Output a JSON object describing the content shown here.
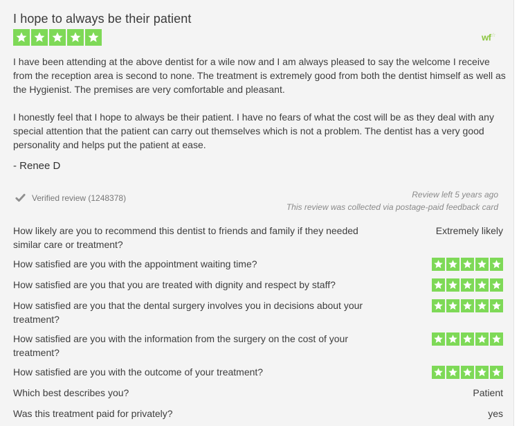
{
  "review": {
    "title": "I hope to always be their patient",
    "rating_stars": 5,
    "logo_text": "wf",
    "paragraphs": [
      "I have been attending at the above dentist for a wile now and I am always pleased to say the welcome I receive from the reception area is second to none. The treatment is extremely good from both the dentist himself as well as the Hygienist. The premises are very comfortable and pleasant.",
      "I honestly feel that I hope to always be their patient. I have no fears of what the cost will be as they deal with any special attention that the patient can carry out themselves which is not a problem. The dentist has a very good personality and helps put the patient at ease."
    ],
    "author": "- Renee D",
    "verified_label": "Verified review (1248378)",
    "review_age": "Review left 5 years ago",
    "collection_note": "This review was collected via postage-paid feedback card"
  },
  "questions": [
    {
      "question": "How likely are you to recommend this dentist to friends and family if they needed similar care or treatment?",
      "answer": "Extremely likely"
    },
    {
      "question": "How satisfied are you with the appointment waiting time?",
      "stars": 5
    },
    {
      "question": "How satisfied are you that you are treated with dignity and respect by staff?",
      "stars": 5
    },
    {
      "question": "How satisfied are you that the dental surgery involves you in decisions about your treatment?",
      "stars": 5
    },
    {
      "question": "How satisfied are you with the information from the surgery on the cost of your treatment?",
      "stars": 5
    },
    {
      "question": "How satisfied are you with the outcome of your treatment?",
      "stars": 5
    },
    {
      "question": "Which best describes you?",
      "answer": "Patient"
    },
    {
      "question": "Was this treatment paid for privately?",
      "answer": "yes"
    }
  ],
  "colors": {
    "star_green": "#7ed957",
    "background": "#f4f4f4"
  }
}
